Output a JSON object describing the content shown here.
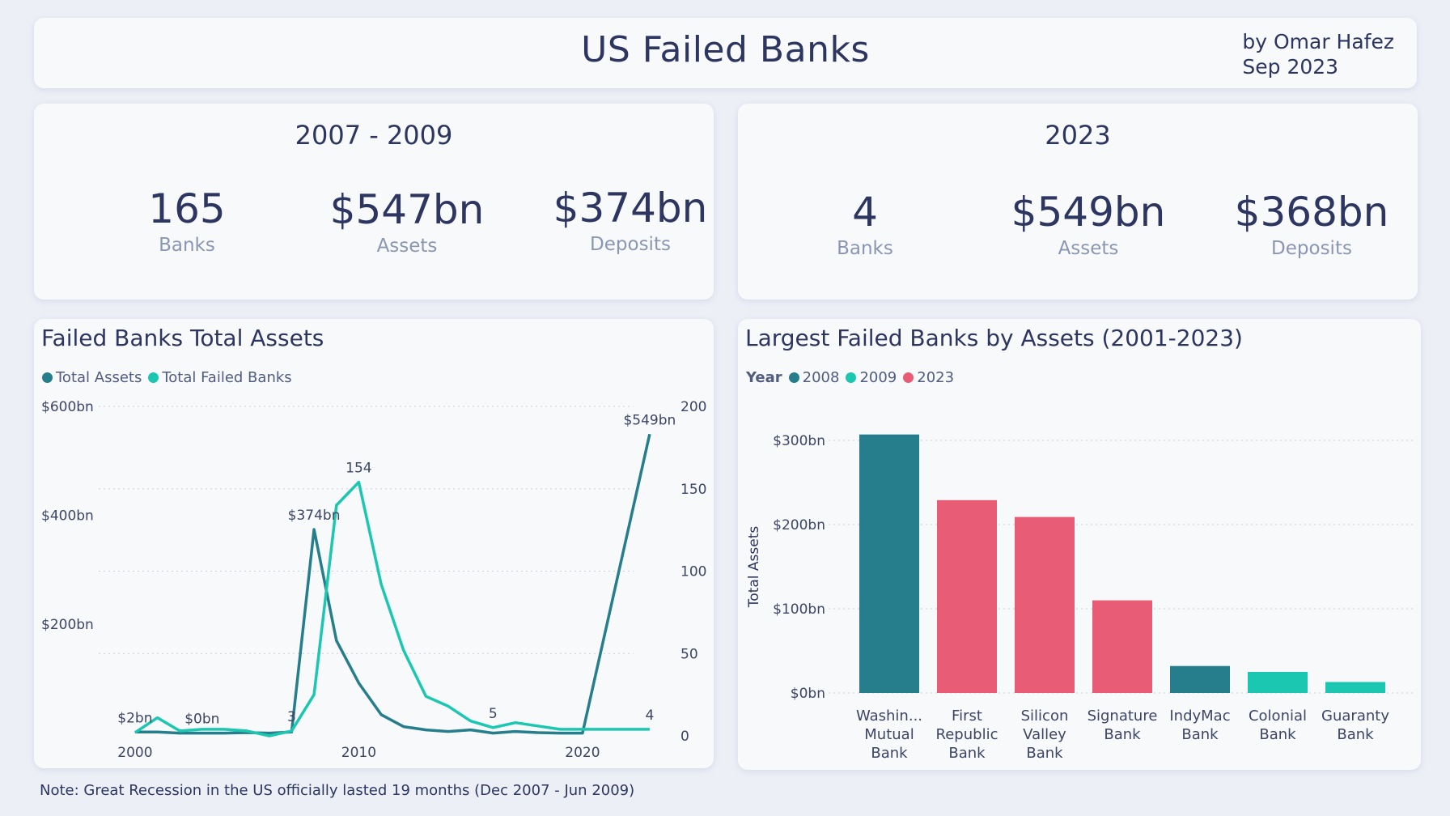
{
  "header": {
    "title": "US Failed Banks",
    "author": "by Omar Hafez",
    "date": "Sep 2023"
  },
  "kpi_left": {
    "title": "2007 - 2009",
    "items": [
      {
        "value": "165",
        "label": "Banks"
      },
      {
        "value": "$547bn",
        "label": "Assets"
      },
      {
        "value": "$374bn",
        "label": "Deposits"
      }
    ]
  },
  "kpi_right": {
    "title": "2023",
    "items": [
      {
        "value": "4",
        "label": "Banks"
      },
      {
        "value": "$549bn",
        "label": "Assets"
      },
      {
        "value": "$368bn",
        "label": "Deposits"
      }
    ]
  },
  "note": "Note: Great Recession in the US officially lasted 19 months (Dec 2007 - Jun 2009)",
  "colors": {
    "teal_dark": "#267e8c",
    "teal_light": "#1cc7b1",
    "pink": "#e85d75",
    "text": "#2d3561"
  },
  "chart_data": [
    {
      "type": "line",
      "title": "Failed Banks Total Assets",
      "x": [
        2000,
        2001,
        2002,
        2003,
        2004,
        2005,
        2006,
        2007,
        2008,
        2009,
        2010,
        2011,
        2012,
        2013,
        2014,
        2015,
        2016,
        2017,
        2018,
        2019,
        2020,
        2023
      ],
      "x_ticks": [
        "2000",
        "2010",
        "2020"
      ],
      "xlim": [
        1999.1,
        2023.8
      ],
      "y_left_ticks": [
        "$600bn",
        "$400bn",
        "$200bn"
      ],
      "y_left_tick_values": [
        600,
        400,
        200
      ],
      "ylim_left": [
        -5,
        600
      ],
      "y_right_ticks": [
        "200",
        "150",
        "100",
        "50",
        "0"
      ],
      "y_right_tick_values": [
        200,
        150,
        100,
        50,
        0
      ],
      "ylim_right": [
        0,
        200
      ],
      "grid": true,
      "legend_position": "top-left",
      "series": [
        {
          "name": "Total Assets",
          "axis": "left",
          "color": "#267e8c",
          "values": [
            2,
            2,
            0,
            0,
            0,
            1,
            0,
            2,
            374,
            170,
            92,
            34,
            12,
            6,
            3,
            6,
            0,
            3,
            1,
            0,
            0,
            549
          ]
        },
        {
          "name": "Total Failed Banks",
          "axis": "right",
          "color": "#1cc7b1",
          "values": [
            2,
            11,
            3,
            4,
            4,
            3,
            0,
            3,
            25,
            140,
            154,
            92,
            52,
            24,
            18,
            9,
            5,
            8,
            6,
            4,
            4,
            4
          ]
        }
      ],
      "data_labels": [
        {
          "text": "$2bn",
          "x": 2000,
          "y": 2,
          "axis": "left"
        },
        {
          "text": "$0bn",
          "x": 2003,
          "y": 0,
          "axis": "left"
        },
        {
          "text": "3",
          "x": 2007,
          "y": 3,
          "axis": "right"
        },
        {
          "text": "$374bn",
          "x": 2008,
          "y": 374,
          "axis": "left"
        },
        {
          "text": "154",
          "x": 2010,
          "y": 154,
          "axis": "right"
        },
        {
          "text": "5",
          "x": 2016,
          "y": 5,
          "axis": "right"
        },
        {
          "text": "4",
          "x": 2023,
          "y": 4,
          "axis": "right"
        },
        {
          "text": "$549bn",
          "x": 2023,
          "y": 549,
          "axis": "left"
        }
      ]
    },
    {
      "type": "bar",
      "title": "Largest Failed Banks by Assets (2001-2023)",
      "legend_title": "Year",
      "legend": [
        {
          "name": "2008",
          "color": "#267e8c"
        },
        {
          "name": "2009",
          "color": "#1cc7b1"
        },
        {
          "name": "2023",
          "color": "#e85d75"
        }
      ],
      "ylabel": "Total Assets",
      "ylim": [
        0,
        300
      ],
      "y_ticks": [
        "$300bn",
        "$200bn",
        "$100bn",
        "$0bn"
      ],
      "y_tick_values": [
        300,
        200,
        100,
        0
      ],
      "grid": true,
      "categories": [
        [
          "Washin...",
          "Mutual",
          "Bank"
        ],
        [
          "First",
          "Republic",
          "Bank"
        ],
        [
          "Silicon",
          "Valley",
          "Bank"
        ],
        [
          "Signature",
          "Bank"
        ],
        [
          "IndyMac",
          "Bank"
        ],
        [
          "Colonial",
          "Bank"
        ],
        [
          "Guaranty",
          "Bank"
        ]
      ],
      "values": [
        307,
        229,
        209,
        110,
        32,
        25,
        13
      ],
      "bar_colors": [
        "#267e8c",
        "#e85d75",
        "#e85d75",
        "#e85d75",
        "#267e8c",
        "#1cc7b1",
        "#1cc7b1"
      ]
    }
  ]
}
